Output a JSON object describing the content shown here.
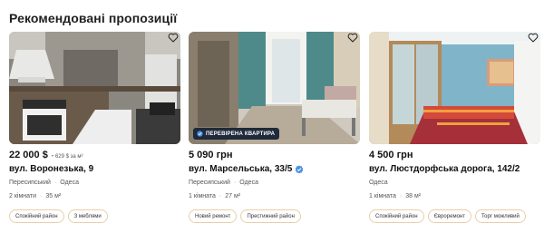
{
  "section": {
    "title": "Рекомендовані пропозиції"
  },
  "colors": {
    "accent": "#4a90e2",
    "tag_border": "#e8cfa9",
    "badge_bg": "#1f2a3a"
  },
  "listings": [
    {
      "price": "22 000 $",
      "price_per_sqm": "629 $ за м²",
      "address": "вул. Воронезька, 9",
      "district": "Пересипський",
      "city": "Одеса",
      "rooms": "2 кімнати",
      "area": "35 м²",
      "tags": [
        "Спокійний район",
        "З меблями"
      ],
      "favorite_icon": "heart-icon"
    },
    {
      "price": "5 090 грн",
      "address": "вул. Марсельська, 33/5",
      "verified_badge": "ПЕРЕВІРЕНА КВАРТИРА",
      "district": "Пересипський",
      "city": "Одеса",
      "rooms": "1 кімната",
      "area": "27 м²",
      "tags": [
        "Новий ремонт",
        "Престижний район"
      ],
      "favorite_icon": "heart-icon"
    },
    {
      "price": "4 500 грн",
      "address": "вул. Люстдорфська дорога, 142/2",
      "district": "",
      "city": "Одеса",
      "rooms": "1 кімната",
      "area": "38 м²",
      "tags": [
        "Спокійний район",
        "Євроремонт",
        "Торг можливий"
      ],
      "favorite_icon": "heart-icon"
    }
  ]
}
